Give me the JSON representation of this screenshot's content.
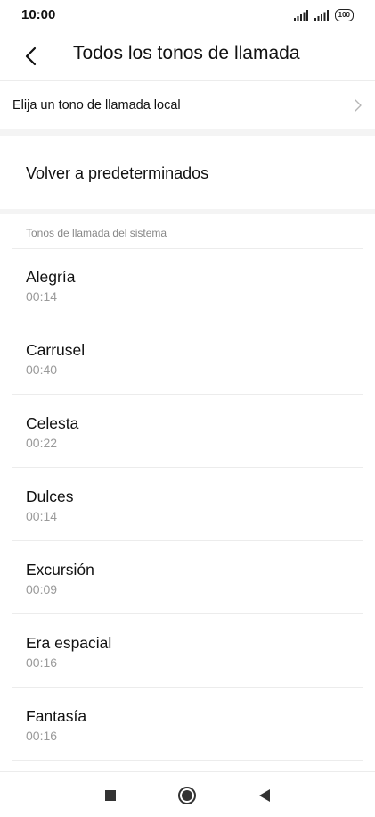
{
  "status_bar": {
    "time": "10:00",
    "battery": "100"
  },
  "header": {
    "title": "Todos los tonos de llamada"
  },
  "local": {
    "label": "Elija un tono de llamada local"
  },
  "reset": {
    "label": "Volver a predeterminados"
  },
  "section": {
    "header": "Tonos de llamada del sistema"
  },
  "ringtones": [
    {
      "name": "Alegría",
      "duration": "00:14"
    },
    {
      "name": "Carrusel",
      "duration": "00:40"
    },
    {
      "name": "Celesta",
      "duration": "00:22"
    },
    {
      "name": "Dulces",
      "duration": "00:14"
    },
    {
      "name": "Excursión",
      "duration": "00:09"
    },
    {
      "name": "Era espacial",
      "duration": "00:16"
    },
    {
      "name": "Fantasía",
      "duration": "00:16"
    }
  ],
  "icons": {
    "back": "back-arrow-icon",
    "chevron": "chevron-right-icon",
    "nav_recent": "square-icon",
    "nav_home": "circle-icon",
    "nav_back": "triangle-back-icon"
  }
}
